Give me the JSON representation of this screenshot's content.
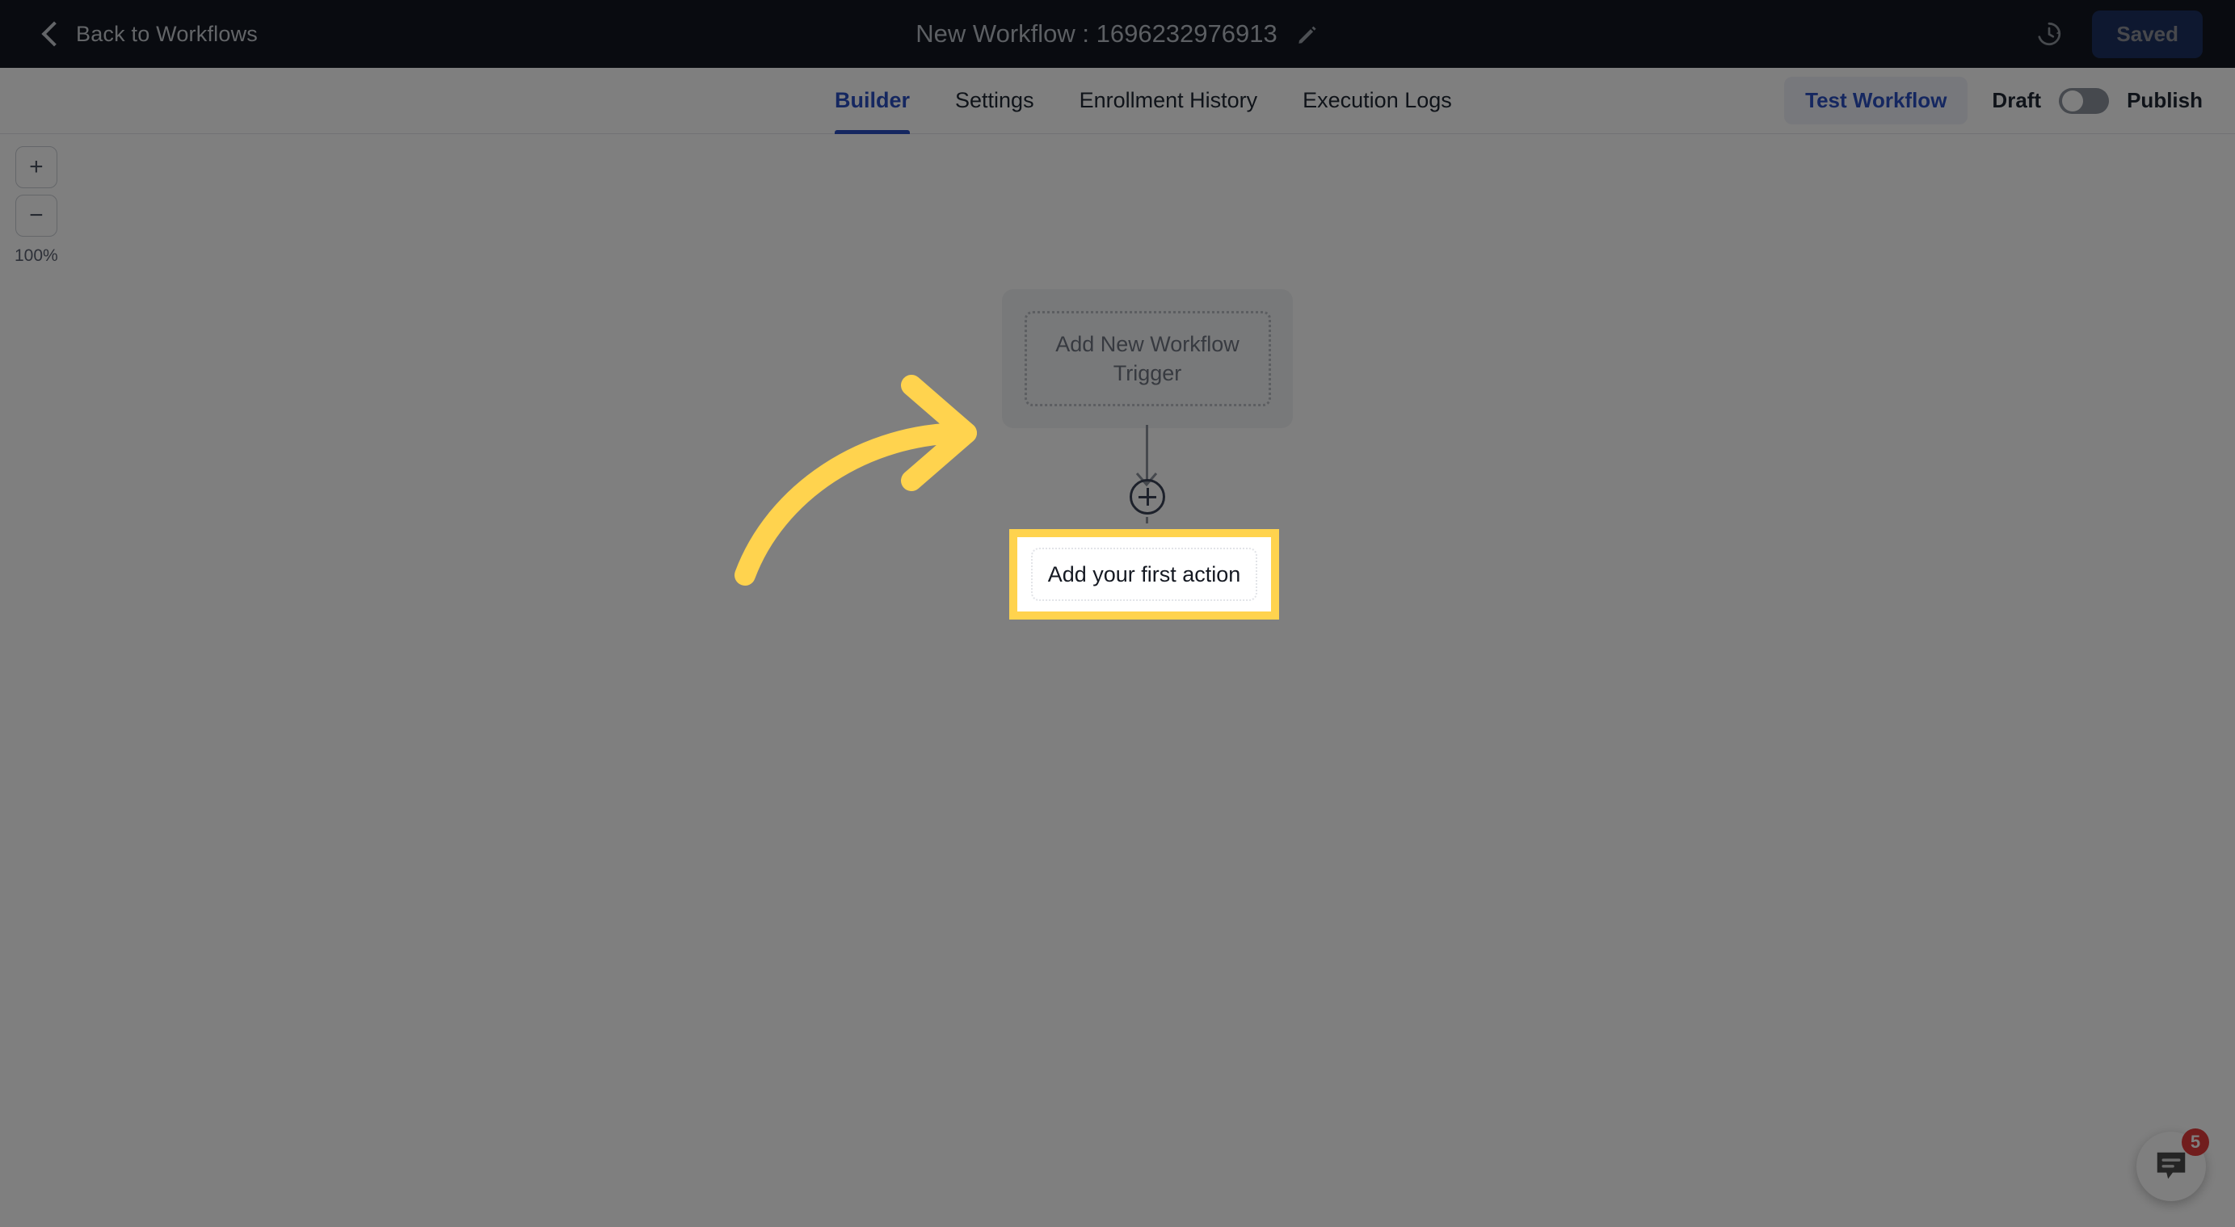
{
  "header": {
    "back_label": "Back to Workflows",
    "back_icon": "chevron-left-icon",
    "title": "New Workflow : 1696232976913",
    "edit_icon": "pencil-icon",
    "history_icon": "history-clock-icon",
    "save_label": "Saved"
  },
  "tabbar": {
    "tabs": [
      {
        "label": "Builder",
        "active": true
      },
      {
        "label": "Settings",
        "active": false
      },
      {
        "label": "Enrollment History",
        "active": false
      },
      {
        "label": "Execution Logs",
        "active": false
      }
    ],
    "test_label": "Test Workflow",
    "draft_label": "Draft",
    "publish_label": "Publish",
    "toggle_state": "off"
  },
  "canvas": {
    "zoom": {
      "in_label": "+",
      "out_label": "−",
      "percent": "100%"
    },
    "trigger_node": {
      "label": "Add New Workflow Trigger"
    },
    "plus_node": {
      "icon": "plus-circle-icon"
    },
    "action_node": {
      "label": "Add your first action",
      "highlighted": true,
      "highlight_color": "#FFD34E"
    }
  },
  "annotation": {
    "arrow_icon": "curved-arrow-right-icon",
    "arrow_color": "#FFD34E"
  },
  "chat": {
    "icon": "chat-bubble-icon",
    "badge_count": "5",
    "badge_color": "#E23A3A"
  },
  "colors": {
    "header_bg": "#121721",
    "accent_blue": "#2B4FC0",
    "saved_bg": "#1D3161",
    "overlay": "rgba(0,0,0,0.5)"
  }
}
